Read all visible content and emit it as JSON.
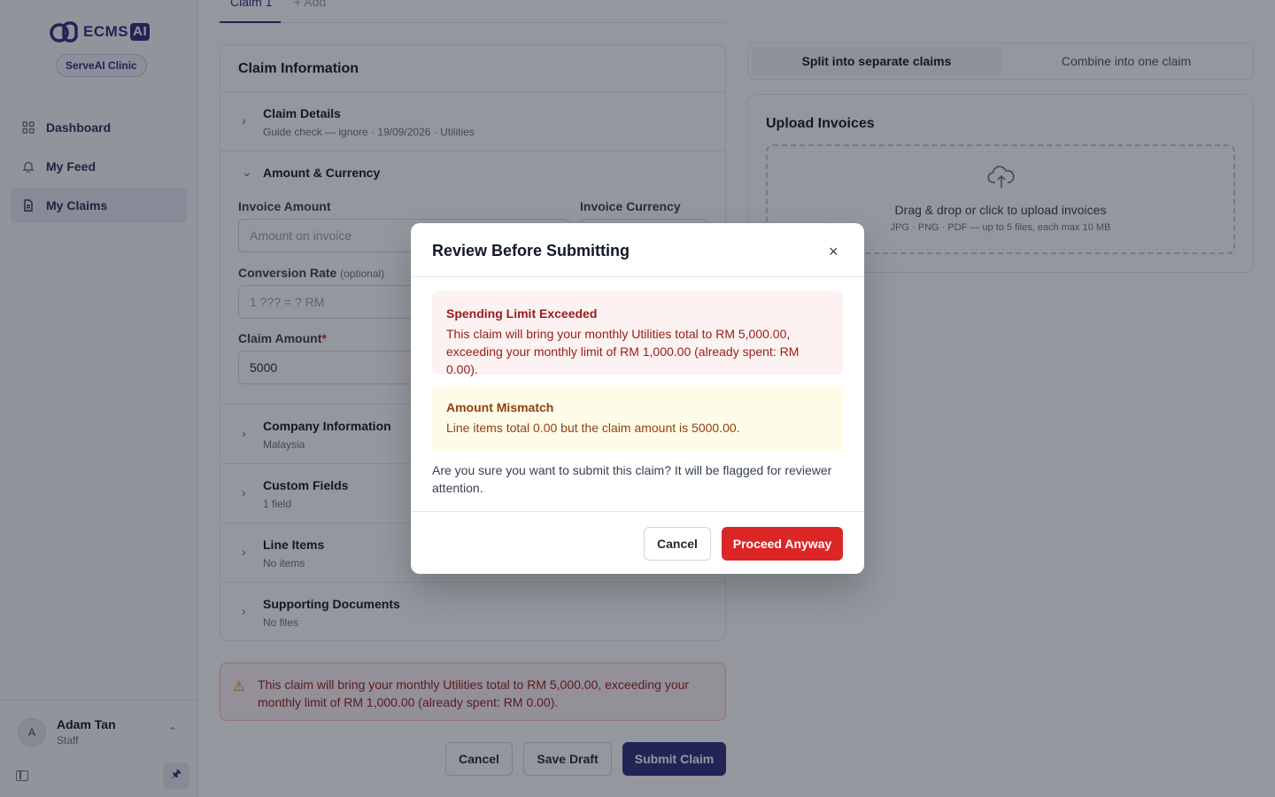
{
  "sidebar": {
    "logo_text": "ECMS",
    "logo_suffix": "AI",
    "clinic": "ServeAI Clinic",
    "items": [
      {
        "label": "Dashboard",
        "icon": "grid-icon"
      },
      {
        "label": "My Feed",
        "icon": "bell-icon"
      },
      {
        "label": "My Claims",
        "icon": "document-icon",
        "active": true
      }
    ],
    "user": {
      "initial": "A",
      "name": "Adam Tan",
      "role": "Staff"
    }
  },
  "tabs": {
    "active": "Claim 1",
    "add": "+ Add"
  },
  "claim": {
    "title": "Claim Information",
    "details": {
      "title": "Claim Details",
      "summary": "Guide check — ignore · 19/09/2026 · Utilities"
    },
    "amount_section": "Amount & Currency",
    "invoice_amount_label": "Invoice Amount",
    "invoice_amount_placeholder": "Amount on invoice",
    "invoice_currency_label": "Invoice Currency",
    "conversion_label": "Conversion Rate",
    "conversion_optional": "(optional)",
    "conversion_placeholder": "1 ??? = ? RM",
    "claim_amount_label": "Claim Amount",
    "claim_amount_required": "*",
    "claim_amount_value": "5000",
    "sections": [
      {
        "title": "Company Information",
        "sub": "Malaysia"
      },
      {
        "title": "Custom Fields",
        "sub": "1 field"
      },
      {
        "title": "Line Items",
        "sub": "No items"
      },
      {
        "title": "Supporting Documents",
        "sub": "No files"
      }
    ]
  },
  "split": {
    "split_label": "Split into separate claims",
    "combine_label": "Combine into one claim"
  },
  "upload": {
    "title": "Upload Invoices",
    "main": "Drag & drop or click to upload invoices",
    "sub": "JPG · PNG · PDF — up to 5 files, each max 10 MB"
  },
  "warning_banner": "This claim will bring your monthly Utilities total to RM 5,000.00, exceeding your monthly limit of RM 1,000.00 (already spent: RM 0.00).",
  "actions": {
    "cancel": "Cancel",
    "save_draft": "Save Draft",
    "submit": "Submit Claim"
  },
  "modal": {
    "title": "Review Before Submitting",
    "close": "×",
    "spending": {
      "title": "Spending Limit Exceeded",
      "body": "This claim will bring your monthly Utilities total to RM 5,000.00, exceeding your monthly limit of RM 1,000.00 (already spent: RM 0.00)."
    },
    "mismatch": {
      "title": "Amount Mismatch",
      "body": "Line items total 0.00 but the claim amount is 5000.00."
    },
    "confirm": "Are you sure you want to submit this claim? It will be flagged for reviewer attention.",
    "cancel": "Cancel",
    "proceed": "Proceed Anyway"
  },
  "colors": {
    "brand": "#2e2f7a",
    "danger": "#dc2626",
    "warning": "#d97706"
  }
}
